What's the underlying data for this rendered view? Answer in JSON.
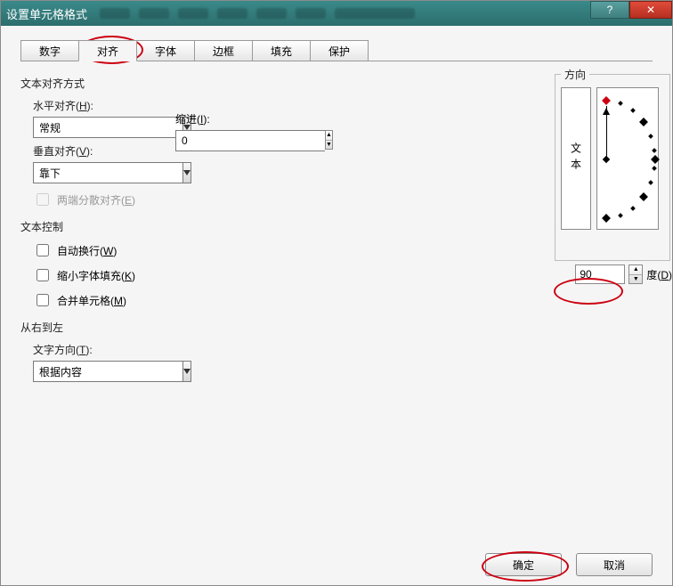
{
  "window": {
    "title": "设置单元格格式"
  },
  "titlebar": {
    "help": "?",
    "close": "✕"
  },
  "tabs": [
    {
      "label": "数字"
    },
    {
      "label": "对齐"
    },
    {
      "label": "字体"
    },
    {
      "label": "边框"
    },
    {
      "label": "填充"
    },
    {
      "label": "保护"
    }
  ],
  "active_tab": 1,
  "sections": {
    "text_alignment": "文本对齐方式",
    "horizontal_label_pre": "水平对齐(",
    "horizontal_key": "H",
    "horizontal_label_post": "):",
    "horizontal_value": "常规",
    "vertical_label_pre": "垂直对齐(",
    "vertical_key": "V",
    "vertical_label_post": "):",
    "vertical_value": "靠下",
    "indent_label_pre": "缩进(",
    "indent_key": "I",
    "indent_label_post": "):",
    "indent_value": "0",
    "justify_pre": "两端分散对齐(",
    "justify_key": "E",
    "justify_post": ")",
    "text_control": "文本控制",
    "wrap_pre": "自动换行(",
    "wrap_key": "W",
    "wrap_post": ")",
    "shrink_pre": "缩小字体填充(",
    "shrink_key": "K",
    "shrink_post": ")",
    "merge_pre": "合并单元格(",
    "merge_key": "M",
    "merge_post": ")",
    "rtl": "从右到左",
    "textdir_pre": "文字方向(",
    "textdir_key": "T",
    "textdir_post": "):",
    "textdir_value": "根据内容"
  },
  "orientation": {
    "legend": "方向",
    "vertical_text": "文本",
    "degree_value": "90",
    "degree_label_pre": "度(",
    "degree_key": "D",
    "degree_label_post": ")"
  },
  "buttons": {
    "ok": "确定",
    "cancel": "取消"
  }
}
